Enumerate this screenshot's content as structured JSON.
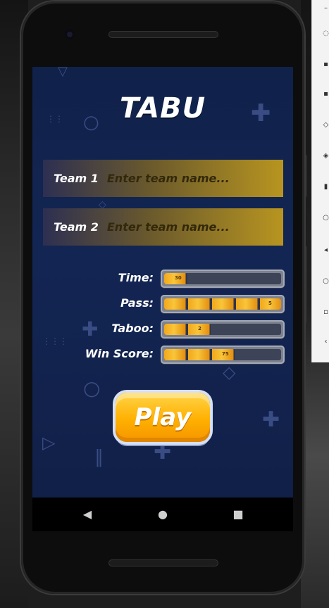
{
  "app": {
    "title": "TABU"
  },
  "teams": [
    {
      "label": "Team 1",
      "placeholder": "Enter team name..."
    },
    {
      "label": "Team 2",
      "placeholder": "Enter team name..."
    }
  ],
  "settings": [
    {
      "label": "Time:",
      "value": "30",
      "fill_fraction": 0.2
    },
    {
      "label": "Pass:",
      "value": "5",
      "fill_fraction": 1.0
    },
    {
      "label": "Taboo:",
      "value": "2",
      "fill_fraction": 0.4
    },
    {
      "label": "Win Score:",
      "value": "75",
      "fill_fraction": 0.6
    }
  ],
  "play_button": {
    "label": "Play"
  },
  "nav": {
    "back_icon": "back-triangle-icon",
    "home_icon": "home-circle-icon",
    "recents_icon": "recents-square-icon"
  },
  "colors": {
    "screen_bg": "#132553",
    "team_bar_gold": "#b89520",
    "slider_fill": "#f9c53a",
    "play_button": "#ffb000"
  }
}
